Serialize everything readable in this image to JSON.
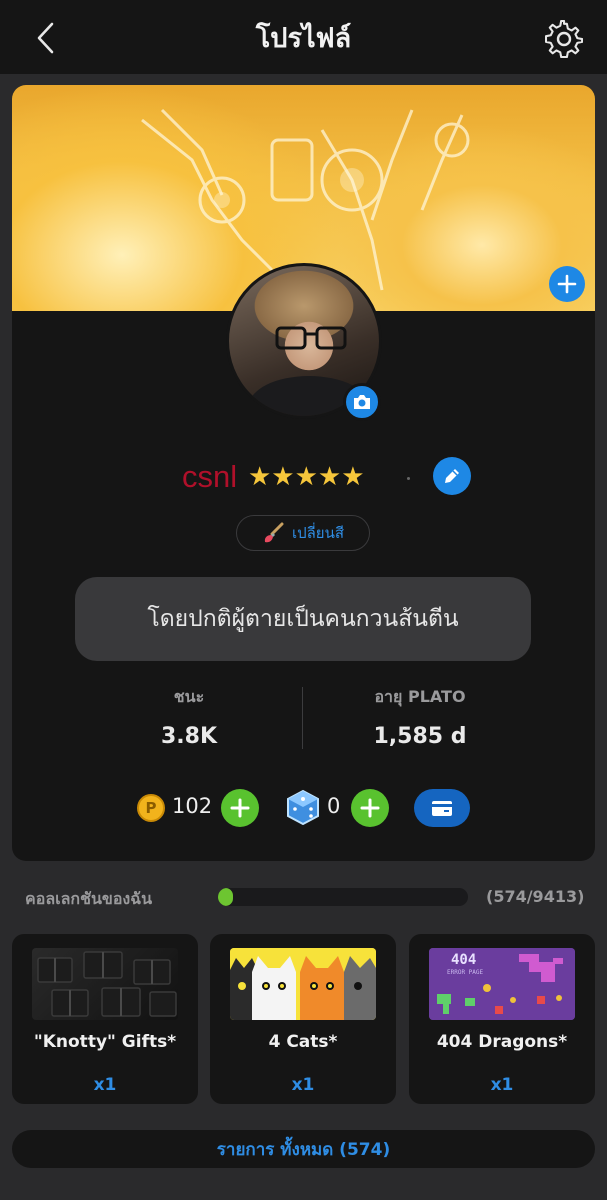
{
  "header": {
    "title": "โปรไฟล์"
  },
  "profile": {
    "username": "csnl",
    "stars": "★★★★★",
    "star_count": 5,
    "change_color_label": "เปลี่ยนสี",
    "bio": "โดยปกติผู้ตายเป็นคนกวนส้นตีน"
  },
  "stats": [
    {
      "label": "ชนะ",
      "value": "3.8K"
    },
    {
      "label": "อายุ PLATO",
      "value": "1,585 d"
    }
  ],
  "currency": {
    "coin_symbol": "P",
    "coins": "102",
    "gems": "0"
  },
  "collection": {
    "title": "คอลเลกชันของฉัน",
    "count_text": "(574/9413)",
    "progress_fraction": 0.061,
    "items": [
      {
        "name": "\"Knotty\" Gifts*",
        "qty": "x1"
      },
      {
        "name": "4 Cats*",
        "qty": "x1"
      },
      {
        "name": "404 Dragons*",
        "qty": "x1"
      }
    ],
    "thumb_404_text": "404",
    "thumb_404_sub": "ERROR PAGE",
    "all_items_label": "รายการ ทั้งหมด (574)"
  },
  "colors": {
    "accent_blue": "#1e88e5",
    "link_blue": "#2f8de4",
    "add_green": "#59c22f",
    "username_red": "#b0102a",
    "star_gold": "#f6c63b"
  },
  "icons": {
    "back": "chevron-left-icon",
    "settings": "gear-icon",
    "banner_add": "plus-icon",
    "camera": "camera-icon",
    "edit": "pencil-icon",
    "brush": "paintbrush-icon",
    "coin": "coin-icon",
    "gem": "dice-gem-icon",
    "wallet": "wallet-icon"
  }
}
